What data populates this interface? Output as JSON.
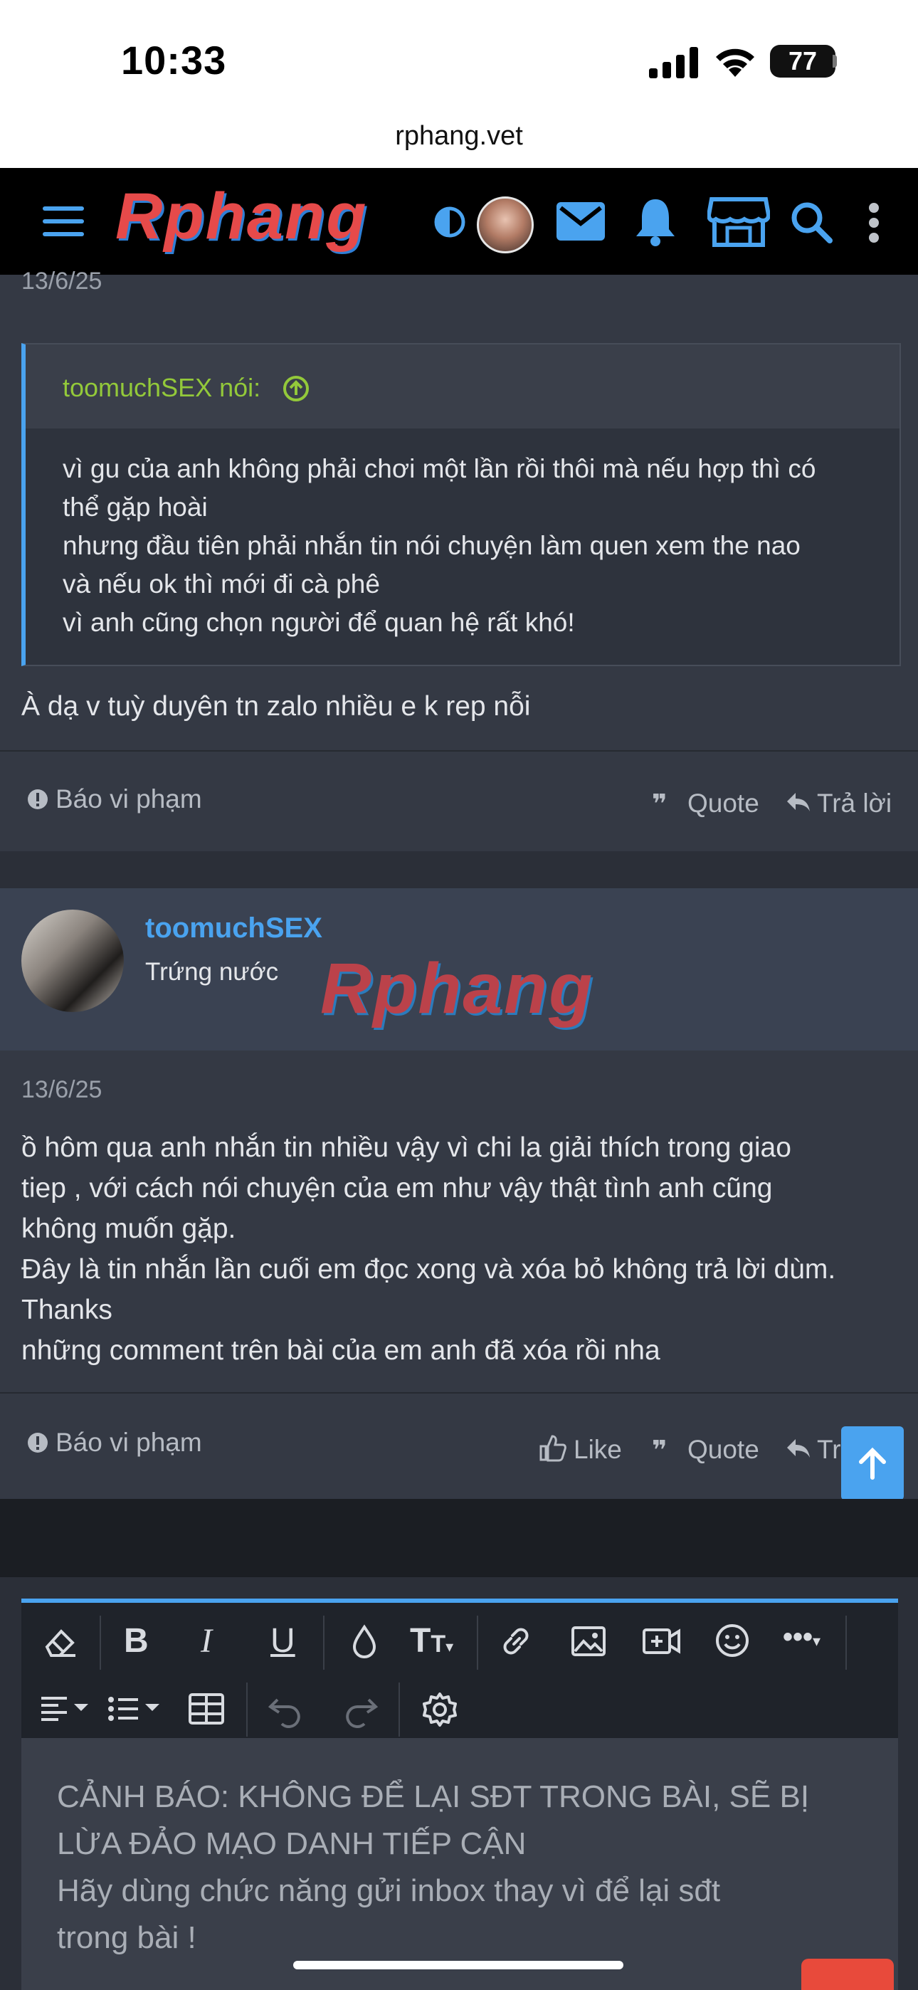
{
  "status_bar": {
    "time": "10:33",
    "battery": "77",
    "url": "rphang.vet"
  },
  "header": {
    "logo_text": "Rphang",
    "icons": [
      "menu-icon",
      "contrast-icon",
      "avatar",
      "mail-icon",
      "bell-icon",
      "store-icon",
      "search-icon",
      "more-vertical-icon"
    ]
  },
  "post1": {
    "date": "13/6/25",
    "quote_author": "toomuchSEX nói:",
    "quote_lines": [
      "vì gu của anh không phải chơi một lần rồi thôi mà nếu hợp thì có",
      "thể gặp hoài",
      "nhưng đầu tiên phải nhắn tin nói chuyện làm quen xem the nao",
      "và nếu ok thì mới đi cà phê",
      "vì anh cũng chọn người để quan hệ rất khó!"
    ],
    "body": "À dạ v tuỳ duyên tn zalo nhiều e k rep nỗi",
    "report": "Báo vi phạm",
    "quote": "Quote",
    "reply": "Trả lời"
  },
  "post2": {
    "username": "toomuchSEX",
    "rank": "Trứng nước",
    "watermark": "Rphang",
    "date": "13/6/25",
    "body_lines": [
      "ồ hôm qua anh nhắn tin nhiều vậy vì chi la giải thích trong giao",
      "tiep , với cách nói chuyện của em như vậy thật tình anh cũng",
      "không muốn gặp.",
      "Đây là tin nhắn lần cuối em đọc xong và xóa bỏ không trả lời dùm.",
      "Thanks",
      "những comment trên bài của em anh đã xóa rồi nha"
    ],
    "report": "Báo vi phạm",
    "like": "Like",
    "quote": "Quote",
    "reply": "Tr"
  },
  "editor": {
    "warning_lines": [
      "CẢNH BÁO: KHÔNG ĐỂ LẠI SĐT TRONG BÀI, SẼ BỊ",
      "LỪA ĐẢO MẠO DANH TIẾP CẬN",
      "Hãy dùng chức năng gửi inbox thay vì để lại sđt",
      "trong bài !"
    ]
  },
  "colors": {
    "accent": "#4aa3ef",
    "quote_author": "#93c93a",
    "username": "#4aa3ef"
  }
}
